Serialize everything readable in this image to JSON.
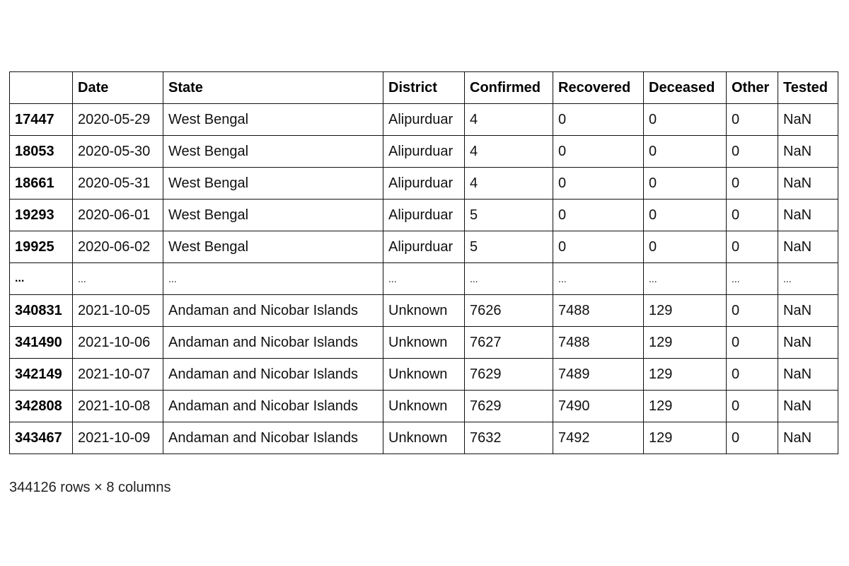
{
  "table": {
    "columns": [
      "",
      "Date",
      "State",
      "District",
      "Confirmed",
      "Recovered",
      "Deceased",
      "Other",
      "Tested"
    ],
    "rows": [
      {
        "index": "17447",
        "cells": [
          "2020-05-29",
          "West Bengal",
          "Alipurduar",
          "4",
          "0",
          "0",
          "0",
          "NaN"
        ]
      },
      {
        "index": "18053",
        "cells": [
          "2020-05-30",
          "West Bengal",
          "Alipurduar",
          "4",
          "0",
          "0",
          "0",
          "NaN"
        ]
      },
      {
        "index": "18661",
        "cells": [
          "2020-05-31",
          "West Bengal",
          "Alipurduar",
          "4",
          "0",
          "0",
          "0",
          "NaN"
        ]
      },
      {
        "index": "19293",
        "cells": [
          "2020-06-01",
          "West Bengal",
          "Alipurduar",
          "5",
          "0",
          "0",
          "0",
          "NaN"
        ]
      },
      {
        "index": "19925",
        "cells": [
          "2020-06-02",
          "West Bengal",
          "Alipurduar",
          "5",
          "0",
          "0",
          "0",
          "NaN"
        ]
      },
      {
        "index": "...",
        "cells": [
          "...",
          "...",
          "...",
          "...",
          "...",
          "...",
          "...",
          "..."
        ]
      },
      {
        "index": "340831",
        "cells": [
          "2021-10-05",
          "Andaman and Nicobar Islands",
          "Unknown",
          "7626",
          "7488",
          "129",
          "0",
          "NaN"
        ]
      },
      {
        "index": "341490",
        "cells": [
          "2021-10-06",
          "Andaman and Nicobar Islands",
          "Unknown",
          "7627",
          "7488",
          "129",
          "0",
          "NaN"
        ]
      },
      {
        "index": "342149",
        "cells": [
          "2021-10-07",
          "Andaman and Nicobar Islands",
          "Unknown",
          "7629",
          "7489",
          "129",
          "0",
          "NaN"
        ]
      },
      {
        "index": "342808",
        "cells": [
          "2021-10-08",
          "Andaman and Nicobar Islands",
          "Unknown",
          "7629",
          "7490",
          "129",
          "0",
          "NaN"
        ]
      },
      {
        "index": "343467",
        "cells": [
          "2021-10-09",
          "Andaman and Nicobar Islands",
          "Unknown",
          "7632",
          "7492",
          "129",
          "0",
          "NaN"
        ]
      }
    ]
  },
  "shape_text": "344126 rows × 8 columns"
}
